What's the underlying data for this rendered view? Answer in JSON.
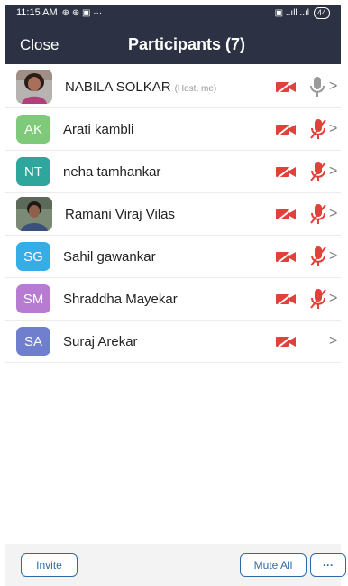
{
  "status_bar": {
    "time": "11:15 AM",
    "app_icons": "⊕ ⊕ ▣ ···",
    "right_icons": "▣ ..ıll ..ıl",
    "battery": "44"
  },
  "header": {
    "close_label": "Close",
    "title": "Participants (7)",
    "background": "#2c3243"
  },
  "participants": [
    {
      "name": "NABILA SOLKAR",
      "tag": "(Host, me)",
      "initials": "",
      "avatar_type": "photo",
      "mic": "on",
      "camera": "off"
    },
    {
      "name": "Arati kambli",
      "tag": "",
      "initials": "AK",
      "avatar_color": "#7fc97a",
      "mic": "muted",
      "camera": "off"
    },
    {
      "name": "neha tamhankar",
      "tag": "",
      "initials": "NT",
      "avatar_color": "#2fa69c",
      "mic": "muted",
      "camera": "off"
    },
    {
      "name": "Ramani Viraj Vilas",
      "tag": "",
      "initials": "",
      "avatar_type": "photo",
      "mic": "muted",
      "camera": "off"
    },
    {
      "name": "Sahil gawankar",
      "tag": "",
      "initials": "SG",
      "avatar_color": "#35aee6",
      "mic": "muted",
      "camera": "off"
    },
    {
      "name": "Shraddha Mayekar",
      "tag": "",
      "initials": "SM",
      "avatar_color": "#b77bd1",
      "mic": "muted",
      "camera": "off"
    },
    {
      "name": "Suraj Arekar",
      "tag": "",
      "initials": "SA",
      "avatar_color": "#6f7fce",
      "mic": "none",
      "camera": "off"
    }
  ],
  "bottom_bar": {
    "invite_label": "Invite",
    "mute_all_label": "Mute All",
    "more_label": "···"
  },
  "colors": {
    "muted_red": "#e0413b",
    "accent_blue": "#2f6aa8"
  }
}
